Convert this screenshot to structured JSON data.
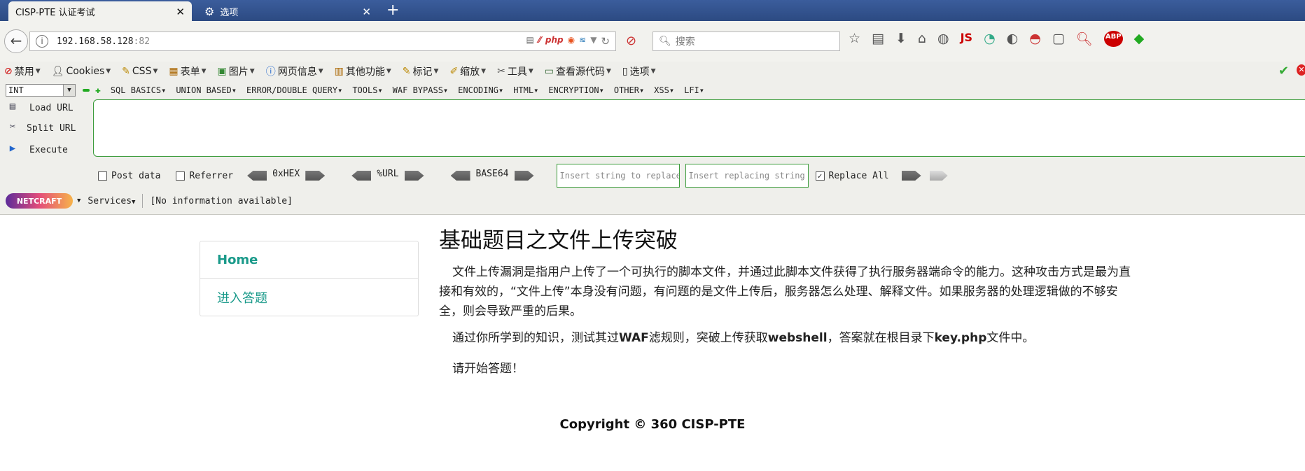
{
  "browser": {
    "tabs": [
      {
        "label": "CISP-PTE 认证考试"
      },
      {
        "label": "选项"
      }
    ],
    "url": "192.168.58.128",
    "url_port": ":82",
    "search_placeholder": "搜索"
  },
  "menubar": {
    "items": [
      {
        "label": "禁用",
        "icon": "disable-icon"
      },
      {
        "label": "Cookies",
        "icon": "user-icon"
      },
      {
        "label": "CSS",
        "icon": "pencil-icon"
      },
      {
        "label": "表单",
        "icon": "form-icon"
      },
      {
        "label": "图片",
        "icon": "image-icon"
      },
      {
        "label": "网页信息",
        "icon": "info-icon"
      },
      {
        "label": "其他功能",
        "icon": "misc-icon"
      },
      {
        "label": "标记",
        "icon": "marker-icon"
      },
      {
        "label": "缩放",
        "icon": "zoom-icon"
      },
      {
        "label": "工具",
        "icon": "tools-icon"
      },
      {
        "label": "查看源代码",
        "icon": "source-icon"
      },
      {
        "label": "选项",
        "icon": "options-icon"
      }
    ]
  },
  "hackbar": {
    "type_select": "INT",
    "menus": [
      "SQL BASICS",
      "UNION BASED",
      "ERROR/DOUBLE QUERY",
      "TOOLS",
      "WAF BYPASS",
      "ENCODING",
      "HTML",
      "ENCRYPTION",
      "OTHER",
      "XSS",
      "LFI"
    ],
    "load_url": "Load URL",
    "split_url": "Split URL",
    "execute": "Execute",
    "post_data": "Post data",
    "referrer": "Referrer",
    "hex": "0xHEX",
    "url_enc": "%URL",
    "base64": "BASE64",
    "replace_placeholder_1": "Insert string to replace",
    "replace_placeholder_2": "Insert replacing string",
    "replace_all": "Replace All"
  },
  "netcraft": {
    "logo": "NETCRAFT",
    "services": "Services",
    "info": "[No information available]"
  },
  "page": {
    "nav": [
      {
        "label": "Home"
      },
      {
        "label": "进入答题"
      }
    ],
    "title": "基础题目之文件上传突破",
    "paragraph1": "文件上传漏洞是指用户上传了一个可执行的脚本文件，并通过此脚本文件获得了执行服务器端命令的能力。这种攻击方式是最为直接和有效的，“文件上传”本身没有问题，有问题的是文件上传后，服务器怎么处理、解释文件。如果服务器的处理逻辑做的不够安全，则会导致严重的后果。",
    "paragraph2_a": "通过你所学到的知识，测试其过",
    "paragraph2_b": "WAF",
    "paragraph2_c": "滤规则，突破上传获取",
    "paragraph2_d": "webshell",
    "paragraph2_e": "，答案就在根目录下",
    "paragraph2_f": "key.php",
    "paragraph2_g": "文件中。",
    "paragraph3": "请开始答题！",
    "copyright": "Copyright © 360 CISP-PTE"
  },
  "colors": {
    "accent": "#1a9a8a",
    "tabstrip": "#2c4a82",
    "hackbar_border": "#3c9c3c"
  }
}
